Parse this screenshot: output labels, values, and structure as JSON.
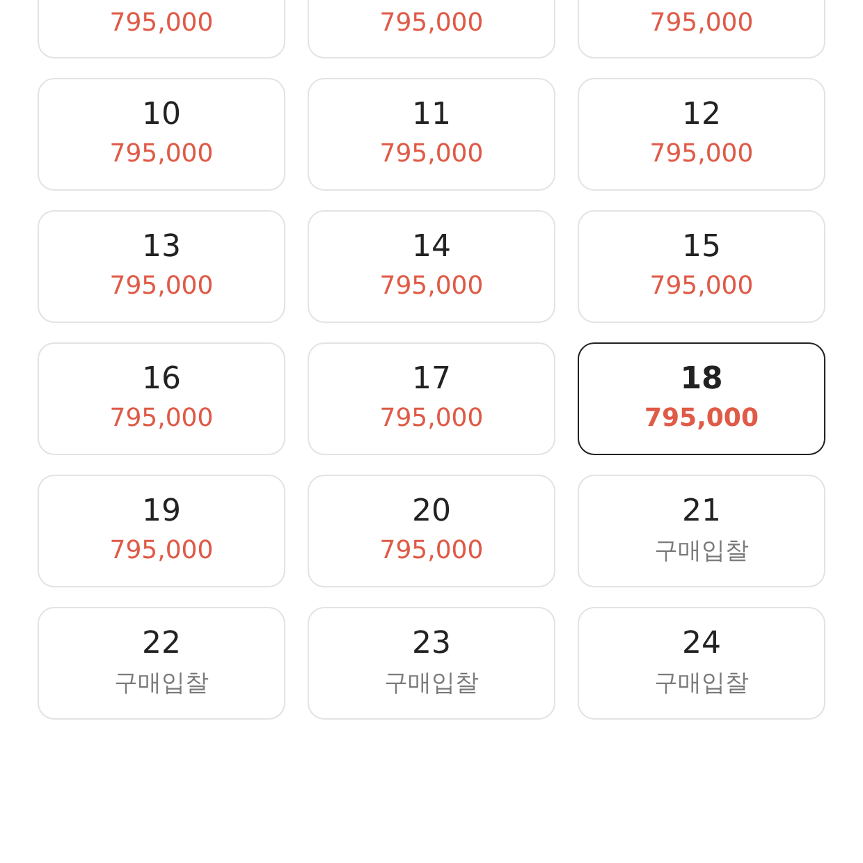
{
  "options": [
    {
      "label": "795,000",
      "kind": "price",
      "selected": false
    },
    {
      "label": "795,000",
      "kind": "price",
      "selected": false
    },
    {
      "label": "795,000",
      "kind": "price",
      "selected": false
    },
    {
      "size": "10",
      "label": "795,000",
      "kind": "price",
      "selected": false
    },
    {
      "size": "11",
      "label": "795,000",
      "kind": "price",
      "selected": false
    },
    {
      "size": "12",
      "label": "795,000",
      "kind": "price",
      "selected": false
    },
    {
      "size": "13",
      "label": "795,000",
      "kind": "price",
      "selected": false
    },
    {
      "size": "14",
      "label": "795,000",
      "kind": "price",
      "selected": false
    },
    {
      "size": "15",
      "label": "795,000",
      "kind": "price",
      "selected": false
    },
    {
      "size": "16",
      "label": "795,000",
      "kind": "price",
      "selected": false
    },
    {
      "size": "17",
      "label": "795,000",
      "kind": "price",
      "selected": false
    },
    {
      "size": "18",
      "label": "795,000",
      "kind": "price",
      "selected": true
    },
    {
      "size": "19",
      "label": "795,000",
      "kind": "price",
      "selected": false
    },
    {
      "size": "20",
      "label": "795,000",
      "kind": "price",
      "selected": false
    },
    {
      "size": "21",
      "label": "구매입찰",
      "kind": "bid",
      "selected": false
    },
    {
      "size": "22",
      "label": "구매입찰",
      "kind": "bid",
      "selected": false
    },
    {
      "size": "23",
      "label": "구매입찰",
      "kind": "bid",
      "selected": false
    },
    {
      "size": "24",
      "label": "구매입찰",
      "kind": "bid",
      "selected": false
    }
  ]
}
